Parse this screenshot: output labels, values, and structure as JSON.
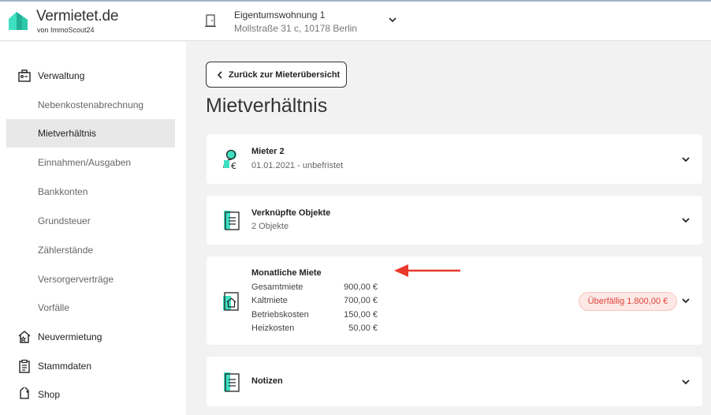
{
  "brand": {
    "name": "Vermietet.de",
    "sub": "von ImmoScout24"
  },
  "property": {
    "title": "Eigentumswohnung 1",
    "address": "Mollstraße 31 c, 10178 Berlin"
  },
  "sidebar": {
    "section_verwaltung": "Verwaltung",
    "items": [
      {
        "label": "Nebenkostenabrechnung"
      },
      {
        "label": "Mietverhältnis"
      },
      {
        "label": "Einnahmen/Ausgaben"
      },
      {
        "label": "Bankkonten"
      },
      {
        "label": "Grundsteuer"
      },
      {
        "label": "Zählerstände"
      },
      {
        "label": "Versorgerverträge"
      },
      {
        "label": "Vorfälle"
      }
    ],
    "section_neuvermietung": "Neuvermietung",
    "section_stammdaten": "Stammdaten",
    "section_shop": "Shop"
  },
  "main": {
    "back_label": "Zurück zur Mieterübersicht",
    "page_title": "Mietverhältnis",
    "tenant": {
      "title": "Mieter 2",
      "sub": "01.01.2021 - unbefristet"
    },
    "objects": {
      "title": "Verknüpfte Objekte",
      "sub": "2 Objekte"
    },
    "rent": {
      "title": "Monatliche Miete",
      "rows": [
        {
          "label": "Gesamtmiete",
          "value": "900,00 €"
        },
        {
          "label": "Kaltmiete",
          "value": "700,00 €"
        },
        {
          "label": "Betriebskosten",
          "value": "150,00 €"
        },
        {
          "label": "Heizkosten",
          "value": "50,00 €"
        }
      ],
      "overdue": "Überfällig 1.800,00 €"
    },
    "notes": {
      "title": "Notizen"
    }
  },
  "colors": {
    "accent": "#3ee0c2",
    "overdue": "#e0433a",
    "arrow": "#e8392b"
  }
}
